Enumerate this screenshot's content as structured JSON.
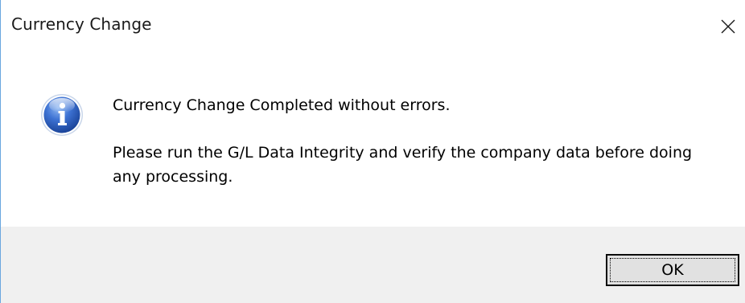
{
  "window": {
    "title": "Currency Change",
    "close_icon": "close-icon"
  },
  "message": {
    "icon": "info-icon",
    "line1": "Currency Change Completed without errors.",
    "line2": "Please run the G/L Data Integrity and verify the company data before doing any processing."
  },
  "footer": {
    "ok_label": "OK"
  },
  "colors": {
    "icon_blue": "#2f5fb8",
    "footer_bg": "#f0f0f0",
    "button_bg": "#e1e1e1"
  }
}
